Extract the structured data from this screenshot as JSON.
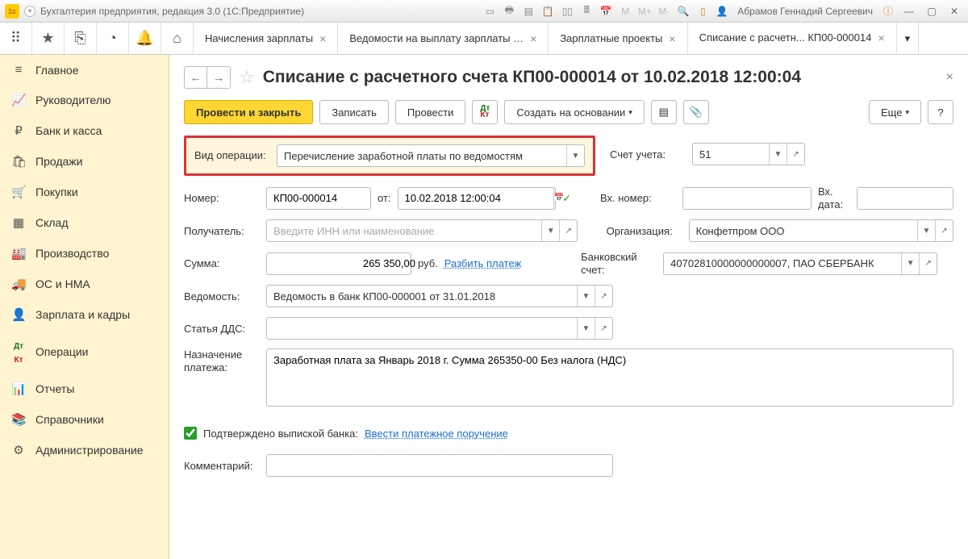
{
  "titlebar": {
    "app_title": "Бухгалтерия предприятия, редакция 3.0  (1С:Предприятие)",
    "user": "Абрамов Геннадий Сергеевич",
    "m_buttons": [
      "М",
      "М+",
      "М-"
    ]
  },
  "tabs": [
    {
      "label": "Начисления зарплаты",
      "closable": true
    },
    {
      "label": "Ведомости на выплату зарплаты …",
      "closable": true
    },
    {
      "label": "Зарплатные проекты",
      "closable": true
    },
    {
      "label": "Списание с расчетн... КП00-000014",
      "closable": true,
      "active": true
    }
  ],
  "sidebar": [
    {
      "icon": "≡",
      "label": "Главное"
    },
    {
      "icon": "📈",
      "label": "Руководителю"
    },
    {
      "icon": "₽",
      "label": "Банк и касса"
    },
    {
      "icon": "🛍",
      "label": "Продажи"
    },
    {
      "icon": "🛒",
      "label": "Покупки"
    },
    {
      "icon": "▦",
      "label": "Склад"
    },
    {
      "icon": "🏭",
      "label": "Производство"
    },
    {
      "icon": "🚚",
      "label": "ОС и НМА"
    },
    {
      "icon": "👤",
      "label": "Зарплата и кадры"
    },
    {
      "icon": "Дт",
      "label": "Операции"
    },
    {
      "icon": "📊",
      "label": "Отчеты"
    },
    {
      "icon": "📚",
      "label": "Справочники"
    },
    {
      "icon": "⚙",
      "label": "Администрирование"
    }
  ],
  "document": {
    "title": "Списание с расчетного счета КП00-000014 от 10.02.2018 12:00:04",
    "buttons": {
      "post_close": "Провести и закрыть",
      "save": "Записать",
      "post": "Провести",
      "create_based": "Создать на основании",
      "more": "Еще"
    },
    "fields": {
      "op_type_label": "Вид операции:",
      "op_type_value": "Перечисление заработной платы по ведомостям",
      "account_label": "Счет учета:",
      "account_value": "51",
      "number_label": "Номер:",
      "number_value": "КП00-000014",
      "date_prefix": "от:",
      "date_value": "10.02.2018 12:00:04",
      "in_number_label": "Вх. номер:",
      "in_number_value": "",
      "in_date_label": "Вх. дата:",
      "in_date_value": "",
      "recipient_label": "Получатель:",
      "recipient_placeholder": "Введите ИНН или наименование",
      "org_label": "Организация:",
      "org_value": "Конфетпром ООО",
      "amount_label": "Сумма:",
      "amount_value": "265 350,00",
      "amount_currency": "руб.",
      "split_link": "Разбить платеж",
      "bank_acc_label": "Банковский счет:",
      "bank_acc_value": "40702810000000000007, ПАО СБЕРБАНК",
      "statement_label": "Ведомость:",
      "statement_value": "Ведомость в банк КП00-000001 от 31.01.2018",
      "dds_label": "Статья ДДС:",
      "dds_value": "",
      "purpose_label": "Назначение платежа:",
      "purpose_value": "Заработная плата за Январь 2018 г. Сумма 265350-00 Без налога (НДС)",
      "confirmed_label": "Подтверждено выпиской банка:",
      "enter_link": "Ввести платежное поручение",
      "comment_label": "Комментарий:",
      "comment_value": ""
    }
  }
}
